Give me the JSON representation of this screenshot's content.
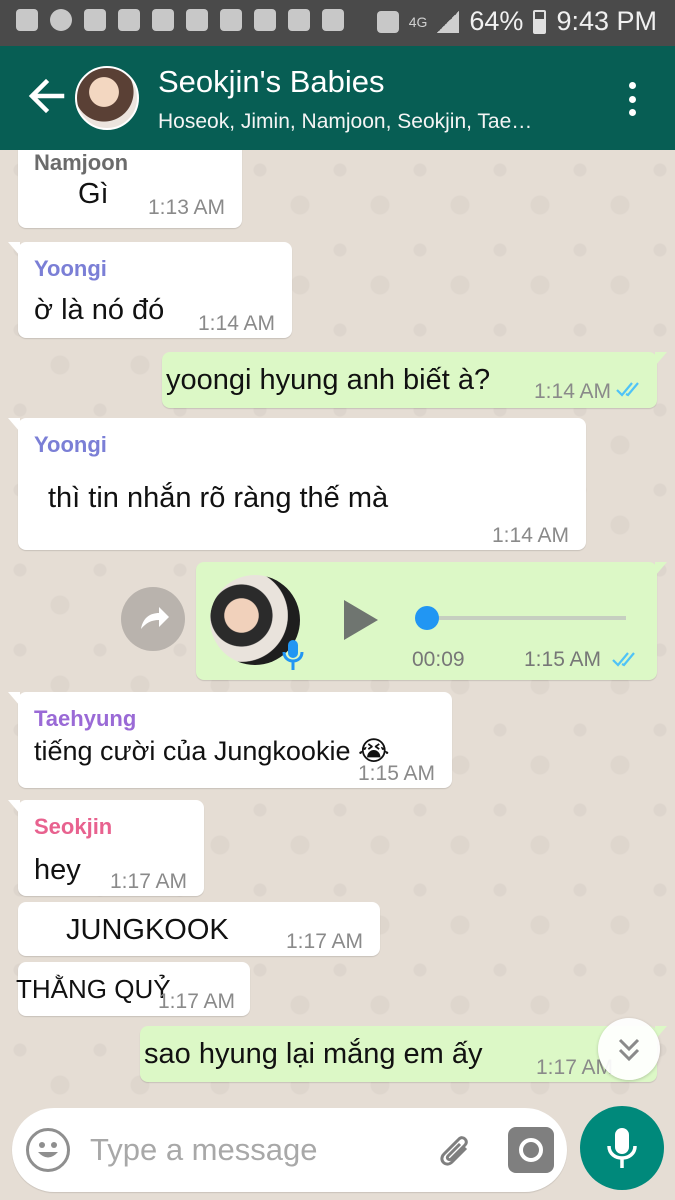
{
  "status_bar": {
    "network": "4G",
    "battery": "64%",
    "time": "9:43 PM",
    "icons": [
      "chat-icon",
      "spotify-icon",
      "facebook-icon",
      "facebook-icon",
      "twitter-icon",
      "gallery-icon",
      "twitter-icon",
      "twitter-icon",
      "screen-icon",
      "twitter-icon",
      "mute-icon",
      "signal-icon",
      "battery-icon"
    ]
  },
  "header": {
    "title": "Seokjin's Babies",
    "subtitle": "Hoseok, Jimin, Namjoon, Seokjin, Tae…"
  },
  "messages": [
    {
      "sender": "Namjoon",
      "text": "Gì",
      "time": "1:13 AM"
    },
    {
      "sender": "Yoongi",
      "text": "ờ là nó đó",
      "time": "1:14 AM"
    },
    {
      "sender": "",
      "text": "yoongi hyung anh biết à?",
      "time": "1:14 AM"
    },
    {
      "sender": "Yoongi",
      "text": "thì tin nhắn rõ ràng thế mà",
      "time": "1:14 AM"
    },
    {
      "sender": "",
      "text": "",
      "time": "1:15 AM",
      "duration": "00:09"
    },
    {
      "sender": "Taehyung",
      "text": "tiếng cười của Jungkookie 😭",
      "time": "1:15 AM"
    },
    {
      "sender": "Seokjin",
      "text": "hey",
      "time": "1:17 AM"
    },
    {
      "sender": "",
      "text": "JUNGKOOK",
      "time": "1:17 AM"
    },
    {
      "sender": "",
      "text": "THẰNG QUỶ",
      "time": "1:17 AM"
    },
    {
      "sender": "",
      "text": "sao hyung lại mắng em ấy",
      "time": "1:17 AM"
    }
  ],
  "input": {
    "placeholder": "Type a message"
  },
  "colors": {
    "app_bar": "#075e54",
    "outgoing_bubble": "#dcf8c6",
    "read_ticks": "#4fc3f7",
    "mic_button": "#00897b",
    "namjoon": "#6b6b6b",
    "yoongi": "#7b7fd6",
    "taehyung": "#9a6ad6",
    "seokjin": "#e8628f"
  }
}
